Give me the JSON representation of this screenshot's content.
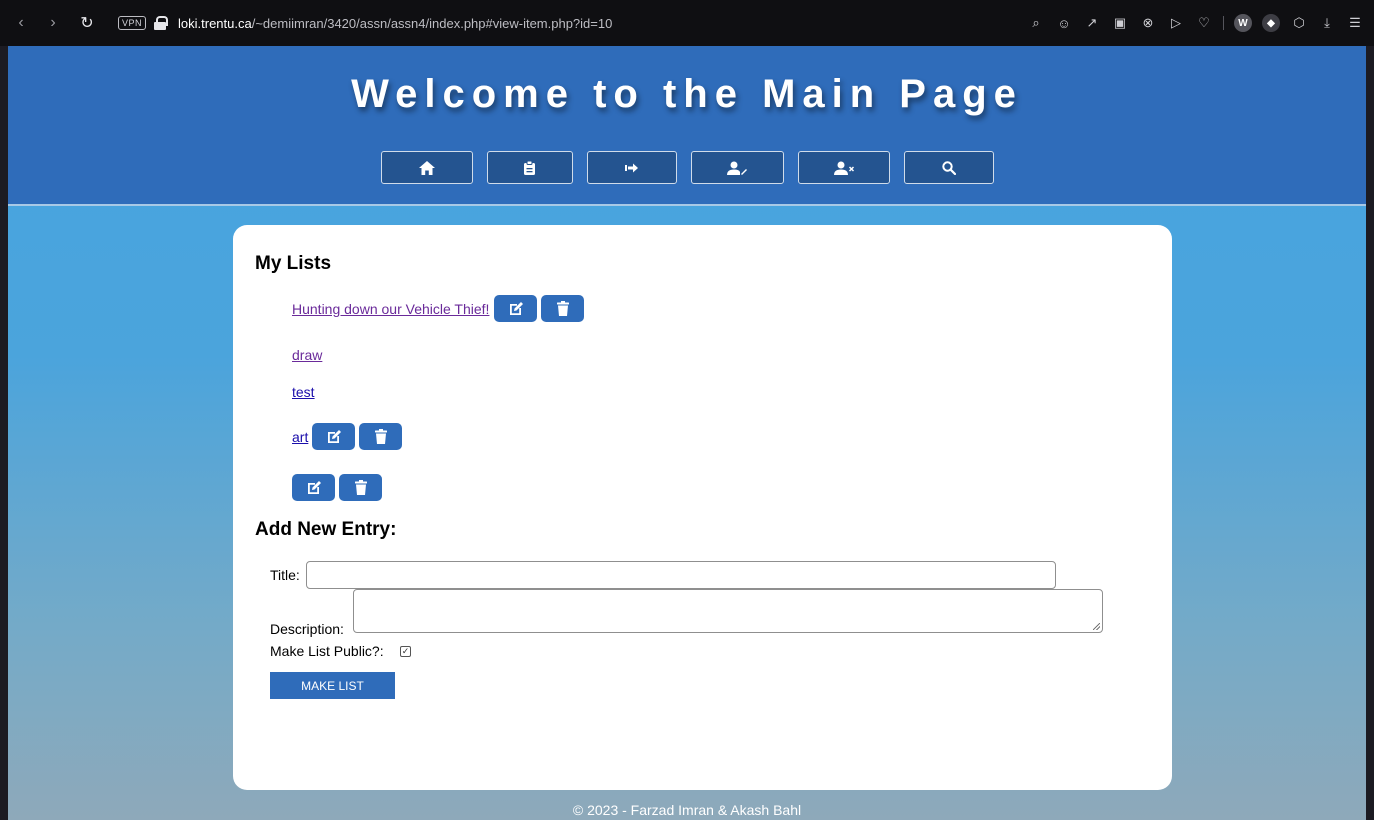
{
  "browser": {
    "vpn_label": "VPN",
    "url_host": "loki.trentu.ca",
    "url_path": "/~demiimran/3420/assn/assn4/index.php#view-item.php?id=10"
  },
  "header": {
    "title": "Welcome to the Main Page",
    "nav": [
      {
        "icon": "home-icon"
      },
      {
        "icon": "clipboard-icon"
      },
      {
        "icon": "logout-icon"
      },
      {
        "icon": "edit-user-icon"
      },
      {
        "icon": "delete-user-icon"
      },
      {
        "icon": "search-icon"
      }
    ]
  },
  "lists": {
    "heading": "My Lists",
    "items": [
      {
        "title": "Hunting down our Vehicle Thief!",
        "editable": true
      },
      {
        "title": "draw",
        "editable": false
      },
      {
        "title": "test",
        "editable": false
      },
      {
        "title": "art",
        "editable": true
      },
      {
        "title": "",
        "editable": true
      }
    ]
  },
  "form": {
    "heading": "Add New Entry:",
    "title_label": "Title:",
    "title_value": "",
    "description_label": "Description:",
    "description_value": "",
    "public_label": "Make List Public?:",
    "public_checked": true,
    "submit_label": "MAKE LIST"
  },
  "footer": {
    "text": "© 2023 - Farzad Imran & Akash Bahl"
  },
  "colors": {
    "header_bg": "#2f6cba",
    "nav_bg": "#245490",
    "button_bg": "#2f6cba",
    "link": "#1a0dab",
    "link_visited": "#6a2a9a"
  }
}
